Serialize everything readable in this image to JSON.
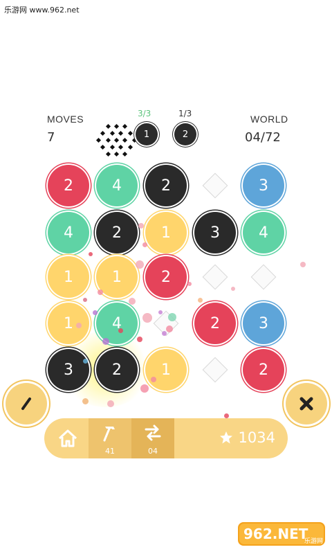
{
  "watermark": "乐游网 www.962.net",
  "header": {
    "moves_label": "MOVES",
    "moves_value": "7",
    "world_label": "WORLD",
    "world_value": "04/72",
    "goals": [
      {
        "progress": "3/3",
        "chip": "1",
        "color": "#5cc47c"
      },
      {
        "progress": "1/3",
        "chip": "2",
        "color": "#333333"
      }
    ]
  },
  "board": {
    "cells": [
      [
        "red:2",
        "green:4",
        "black:2",
        "empty",
        "blue:3"
      ],
      [
        "green:4",
        "black:2",
        "yellow:1",
        "black:3",
        "green:4"
      ],
      [
        "yellow:1",
        "yellow:1",
        "red:2",
        "empty",
        "empty"
      ],
      [
        "yellow:1",
        "green:4",
        "empty",
        "red:2",
        "blue:3"
      ],
      [
        "black:3",
        "black:2",
        "yellow:1",
        "empty",
        "red:2"
      ]
    ]
  },
  "side_buttons": {
    "left_icon": "pencil-icon",
    "right_icon": "close-icon"
  },
  "toolbar": {
    "home_icon": "home-icon",
    "hammer_icon": "hammer-icon",
    "hammer_count": "41",
    "swap_icon": "swap-icon",
    "swap_count": "04",
    "star_icon": "star-icon",
    "score": "1034"
  },
  "logo_text": "962.NET",
  "logo_subtext": "乐游网",
  "colors": {
    "red": "#e5435a",
    "green": "#5fd3a5",
    "black": "#2a2a2a",
    "blue": "#5ea5d9",
    "yellow": "#ffd56c",
    "bar": "#f9d686"
  }
}
